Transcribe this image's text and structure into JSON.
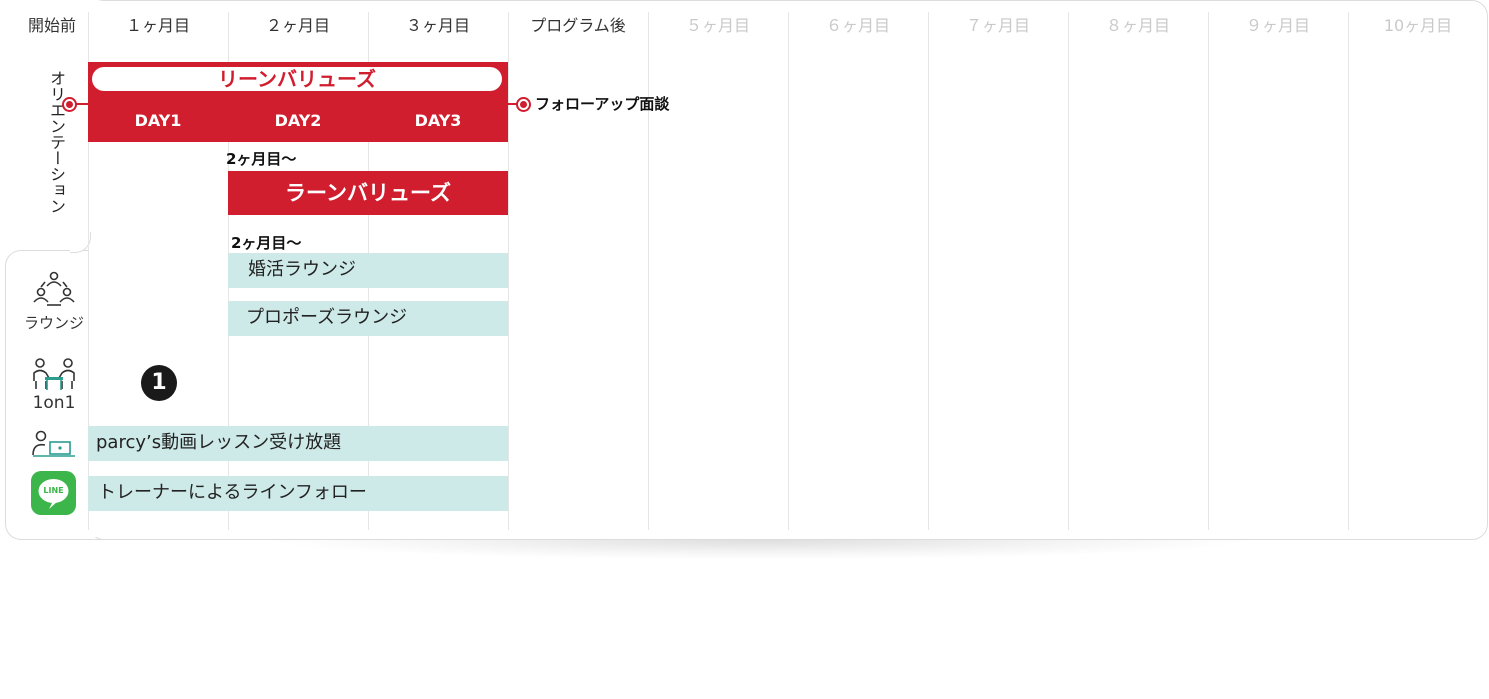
{
  "header": {
    "pre": "開始前",
    "months": [
      {
        "label": "１ヶ月目",
        "faded": false
      },
      {
        "label": "２ヶ月目",
        "faded": false
      },
      {
        "label": "３ヶ月目",
        "faded": false
      },
      {
        "label": "プログラム後",
        "faded": false
      },
      {
        "label": "５ヶ月目",
        "faded": true
      },
      {
        "label": "６ヶ月目",
        "faded": true
      },
      {
        "label": "７ヶ月目",
        "faded": true
      },
      {
        "label": "８ヶ月目",
        "faded": true
      },
      {
        "label": "９ヶ月目",
        "faded": true
      },
      {
        "label": "10ヶ月目",
        "faded": true
      }
    ]
  },
  "orientation": {
    "label": "オリエンテーション"
  },
  "lean_values": {
    "title": "リーンバリューズ",
    "days": [
      "DAY1",
      "DAY2",
      "DAY3"
    ],
    "followup": "フォローアップ面談"
  },
  "learn_values": {
    "start_note": "2ヶ月目〜",
    "title": "ラーンバリューズ"
  },
  "lounge": {
    "start_note": "2ヶ月目〜",
    "items": [
      "婚活ラウンジ",
      "プロポーズラウンジ"
    ],
    "side_label": "ラウンジ",
    "icon": "recycle-people-icon"
  },
  "one_on_one": {
    "side_label": "1on1",
    "badge": "1",
    "icon": "two-people-talking-icon"
  },
  "video": {
    "text": "parcy’s動画レッスン受け放題",
    "icon": "person-laptop-icon"
  },
  "line": {
    "text": "トレーナーによるラインフォロー",
    "icon_text": "LINE",
    "icon": "line-app-icon"
  },
  "colors": {
    "red": "#d01e2e",
    "teal": "#cde9e8",
    "line_green": "#3cb54a",
    "icon_teal": "#2a9d8f"
  }
}
